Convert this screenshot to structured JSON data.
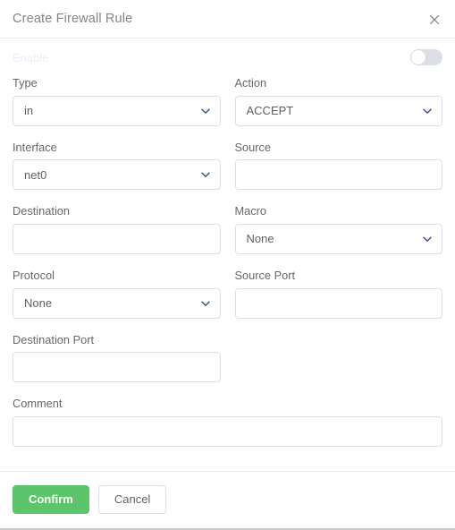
{
  "dialog": {
    "title": "Create Firewall Rule",
    "close_icon": "close-icon"
  },
  "enable": {
    "label": "Enable",
    "state": "off"
  },
  "fields": {
    "type": {
      "label": "Type",
      "value": "in",
      "kind": "select"
    },
    "action": {
      "label": "Action",
      "value": "ACCEPT",
      "kind": "select"
    },
    "interface": {
      "label": "Interface",
      "value": "net0",
      "kind": "select"
    },
    "source": {
      "label": "Source",
      "value": "",
      "kind": "input"
    },
    "destination": {
      "label": "Destination",
      "value": "",
      "kind": "input"
    },
    "macro": {
      "label": "Macro",
      "value": "None",
      "kind": "select"
    },
    "protocol": {
      "label": "Protocol",
      "value": "None",
      "kind": "select"
    },
    "source_port": {
      "label": "Source Port",
      "value": "",
      "kind": "input"
    },
    "destination_port": {
      "label": "Destination Port",
      "value": "",
      "kind": "input"
    },
    "comment": {
      "label": "Comment",
      "value": "",
      "kind": "input"
    }
  },
  "footer": {
    "confirm_label": "Confirm",
    "cancel_label": "Cancel"
  },
  "colors": {
    "accent_green": "#5cc46a",
    "border": "#dcdfe6",
    "label_text": "#65676b",
    "title_text": "#82848a",
    "chevron": "#2b4a7d",
    "toggle_track_off": "#dcdfe6",
    "enable_label": "#e9eff7"
  }
}
